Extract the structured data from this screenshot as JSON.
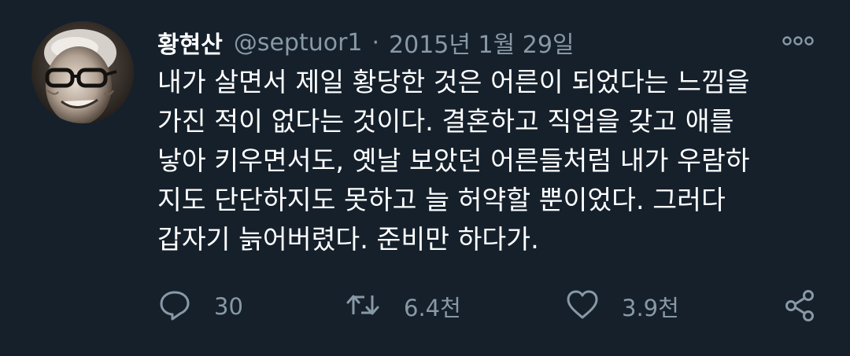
{
  "tweet": {
    "display_name": "황현산",
    "handle": "@septuor1",
    "separator": "·",
    "date": "2015년 1월 29일",
    "text_lines": [
      "내가 살면서 제일 황당한 것은 어른이 되었다는 느낌을",
      "가진 적이 없다는 것이다. 결혼하고 직업을 갖고 애를",
      "낳아 키우면서도, 옛날 보았던 어른들처럼 내가 우람하",
      "지도 단단하지도 못하고 늘 허약할 뿐이었다. 그러다",
      "갑자기 늙어버렸다. 준비만 하다가."
    ],
    "actions": {
      "reply_count": "30",
      "retweet_count": "6.4천",
      "like_count": "3.9천"
    }
  },
  "icons": {
    "more": "more-icon",
    "reply": "reply-icon",
    "retweet": "retweet-icon",
    "like": "like-icon",
    "share": "share-icon"
  },
  "colors": {
    "background": "#15202b",
    "text_primary": "#ffffff",
    "text_secondary": "#8899a6"
  }
}
